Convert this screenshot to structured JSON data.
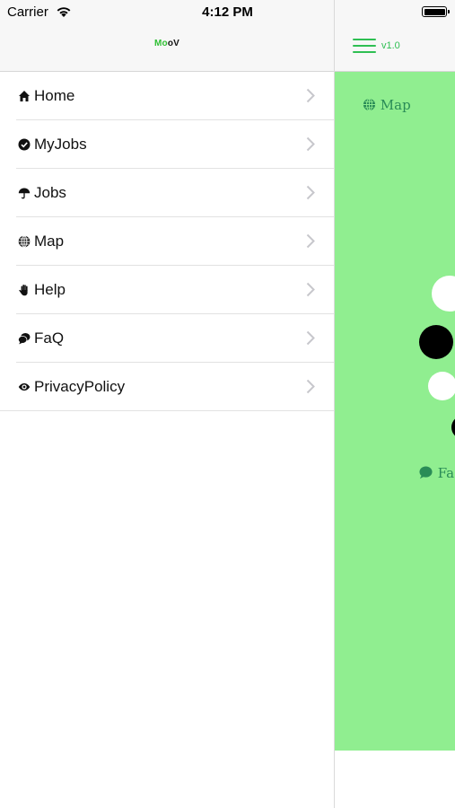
{
  "status_bar": {
    "carrier": "Carrier",
    "time": "4:12 PM"
  },
  "drawer": {
    "logo": {
      "part1": "Mo",
      "part2": "o",
      "part3": "V"
    },
    "items": [
      {
        "label": "Home",
        "icon": "home-icon"
      },
      {
        "label": "MyJobs",
        "icon": "check-circle-icon"
      },
      {
        "label": "Jobs",
        "icon": "umbrella-icon"
      },
      {
        "label": "Map",
        "icon": "globe-icon"
      },
      {
        "label": "Help",
        "icon": "hand-icon"
      },
      {
        "label": "FaQ",
        "icon": "chat-bubbles-icon"
      },
      {
        "label": "PrivacyPolicy",
        "icon": "eye-icon"
      }
    ]
  },
  "main": {
    "version": "v1.0",
    "map_link": "Map",
    "faq_link_partial": "FaQ"
  },
  "colors": {
    "accent_green": "#2fbf53",
    "panel_green": "#90ee90",
    "link_green": "#2a8c57"
  }
}
